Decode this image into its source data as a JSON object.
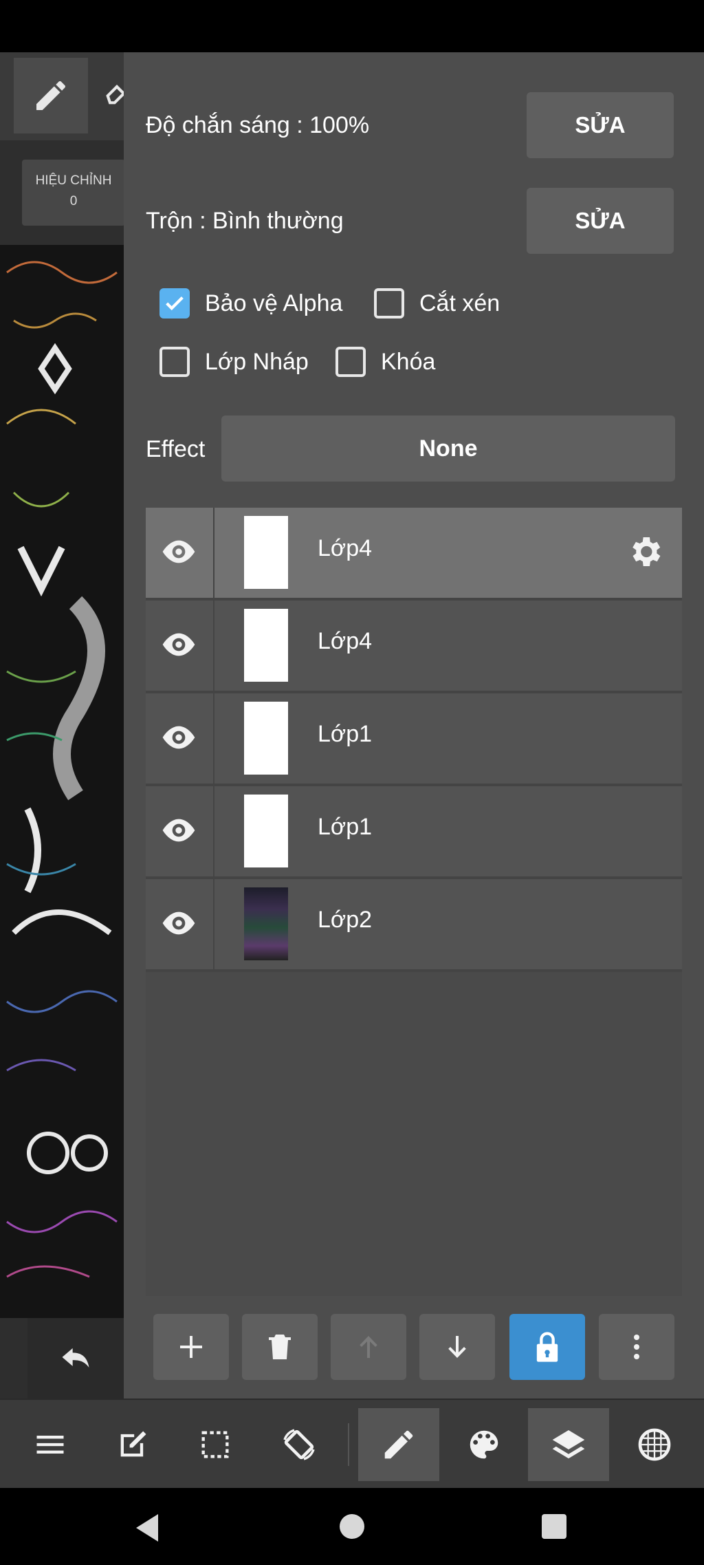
{
  "left": {
    "adjust_label": "HIỆU CHỈNH",
    "adjust_value": "0"
  },
  "panel": {
    "opacity_label": "Độ chắn sáng : 100%",
    "opacity_edit": "SỬA",
    "blend_label": "Trộn : Bình thường",
    "blend_edit": "SỬA",
    "checkboxes": [
      {
        "label": "Bảo vệ Alpha",
        "checked": true
      },
      {
        "label": "Cắt xén",
        "checked": false
      },
      {
        "label": "Lớp Nháp",
        "checked": false
      },
      {
        "label": "Khóa",
        "checked": false
      }
    ],
    "effect_label": "Effect",
    "effect_value": "None"
  },
  "layers": [
    {
      "name": "Lớp4",
      "selected": true,
      "visible": true
    },
    {
      "name": "Lớp4",
      "selected": false,
      "visible": true
    },
    {
      "name": "Lớp1",
      "selected": false,
      "visible": true
    },
    {
      "name": "Lớp1",
      "selected": false,
      "visible": true
    },
    {
      "name": "Lớp2",
      "selected": false,
      "visible": true
    }
  ],
  "layer_actions": [
    "add-icon",
    "trash-icon",
    "arrow-up-icon",
    "arrow-down-icon",
    "lock-icon",
    "more-vertical-icon"
  ],
  "bottom_toolbar": [
    "menu-icon",
    "edit-icon",
    "selection-icon",
    "rotate-icon",
    "pen-icon",
    "palette-icon",
    "layers-icon",
    "grid-globe-icon"
  ],
  "colors": {
    "accent": "#5ab2f0",
    "lock_active": "#3b8fd0",
    "panel": "#4d4d4d"
  }
}
